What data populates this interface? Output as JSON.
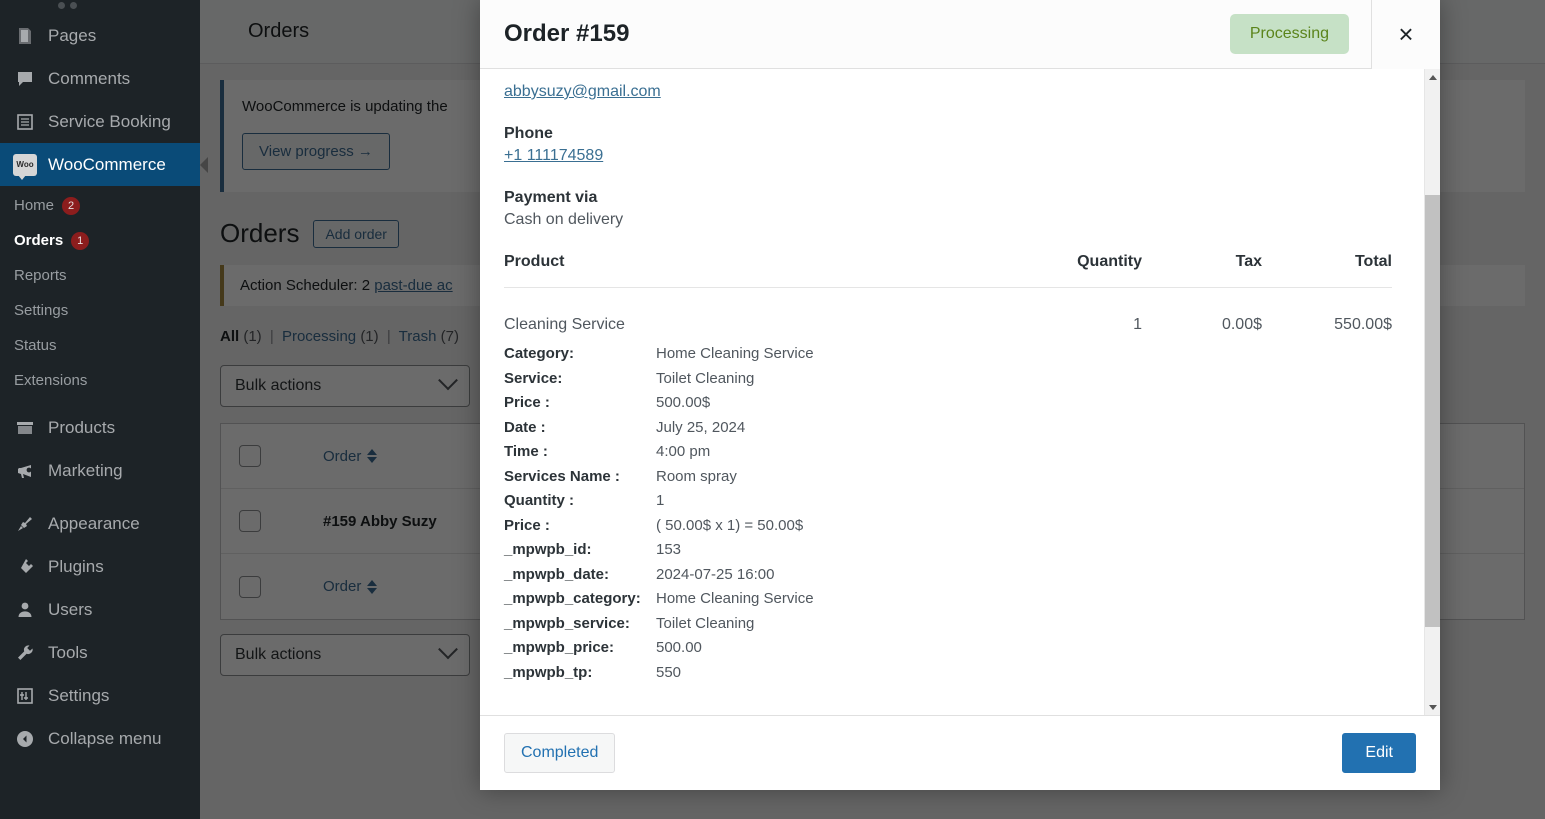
{
  "sidebar": {
    "items": [
      {
        "label": "Pages",
        "icon": "pages-icon",
        "id": "pages"
      },
      {
        "label": "Comments",
        "icon": "comments-icon",
        "id": "comments"
      },
      {
        "label": "Service Booking",
        "icon": "list-icon",
        "id": "service-booking"
      },
      {
        "label": "WooCommerce",
        "icon": "woo-icon",
        "id": "woocommerce",
        "current": true
      },
      {
        "label": "Products",
        "icon": "products-icon",
        "id": "products"
      },
      {
        "label": "Marketing",
        "icon": "marketing-icon",
        "id": "marketing"
      },
      {
        "label": "Appearance",
        "icon": "appearance-icon",
        "id": "appearance"
      },
      {
        "label": "Plugins",
        "icon": "plugins-icon",
        "id": "plugins"
      },
      {
        "label": "Users",
        "icon": "users-icon",
        "id": "users"
      },
      {
        "label": "Tools",
        "icon": "tools-icon",
        "id": "tools"
      },
      {
        "label": "Settings",
        "icon": "settings-icon",
        "id": "settings"
      },
      {
        "label": "Collapse menu",
        "icon": "collapse-icon",
        "id": "collapse-menu"
      }
    ],
    "woo_submenu": [
      {
        "label": "Home",
        "badge": "2"
      },
      {
        "label": "Orders",
        "badge": "1",
        "current": true
      },
      {
        "label": "Reports",
        "badge": ""
      },
      {
        "label": "Settings",
        "badge": ""
      },
      {
        "label": "Status",
        "badge": ""
      },
      {
        "label": "Extensions",
        "badge": ""
      }
    ],
    "woo_logo_text": "Woo"
  },
  "background": {
    "topbar_title": "Orders",
    "notice_updating": "WooCommerce is updating the",
    "view_progress_label": "View progress →",
    "page_title": "Orders",
    "add_order_label": "Add order",
    "scheduler_prefix": "Action Scheduler: 2",
    "scheduler_link": "past-due ac",
    "filters": [
      {
        "label": "All",
        "count": "(1)",
        "current": true
      },
      {
        "label": "Processing",
        "count": "(1)",
        "current": false
      },
      {
        "label": "Trash",
        "count": "(7)",
        "current": false
      }
    ],
    "bulk_actions_label": "Bulk actions",
    "table": {
      "header_col": "Order",
      "rows": [
        {
          "order": "#159 Abby Suzy"
        }
      ],
      "footer_col": "Order"
    },
    "bulk_actions_bottom_label": "Bulk actions"
  },
  "modal": {
    "title": "Order #159",
    "status": "Processing",
    "close_label": "×",
    "customer": {
      "email": "abbysuzy@gmail.com",
      "phone_label": "Phone",
      "phone": "+1 111174589",
      "payment_label": "Payment via",
      "payment_method": "Cash on delivery"
    },
    "products_table": {
      "headers": {
        "product": "Product",
        "quantity": "Quantity",
        "tax": "Tax",
        "total": "Total"
      },
      "row": {
        "name": "Cleaning Service",
        "quantity": "1",
        "tax": "0.00$",
        "total": "550.00$"
      },
      "meta": [
        {
          "key": "Category:",
          "value": "Home Cleaning Service"
        },
        {
          "key": "Service:",
          "value": "Toilet Cleaning"
        },
        {
          "key": "Price :",
          "value": "500.00$"
        },
        {
          "key": "Date :",
          "value": "July 25, 2024"
        },
        {
          "key": "Time :",
          "value": "4:00 pm"
        },
        {
          "key": "Services Name :",
          "value": "Room spray"
        },
        {
          "key": "Quantity :",
          "value": "1"
        },
        {
          "key": "Price :",
          "value": "( 50.00$ x 1) = 50.00$"
        },
        {
          "key": "_mpwpb_id:",
          "value": "153"
        },
        {
          "key": "_mpwpb_date:",
          "value": "2024-07-25 16:00"
        },
        {
          "key": "_mpwpb_category:",
          "value": "Home Cleaning Service"
        },
        {
          "key": "_mpwpb_service:",
          "value": "Toilet Cleaning"
        },
        {
          "key": "_mpwpb_price:",
          "value": "500.00"
        },
        {
          "key": "_mpwpb_tp:",
          "value": "550"
        }
      ]
    },
    "footer": {
      "completed_label": "Completed",
      "edit_label": "Edit"
    }
  },
  "colors": {
    "status_pill_bg": "#c6e1c6",
    "status_pill_text": "#5b841b",
    "primary_button": "#2271b1",
    "sidebar_bg": "#1d2327",
    "sidebar_current": "#0a4b78",
    "link": "#3a6f92"
  }
}
